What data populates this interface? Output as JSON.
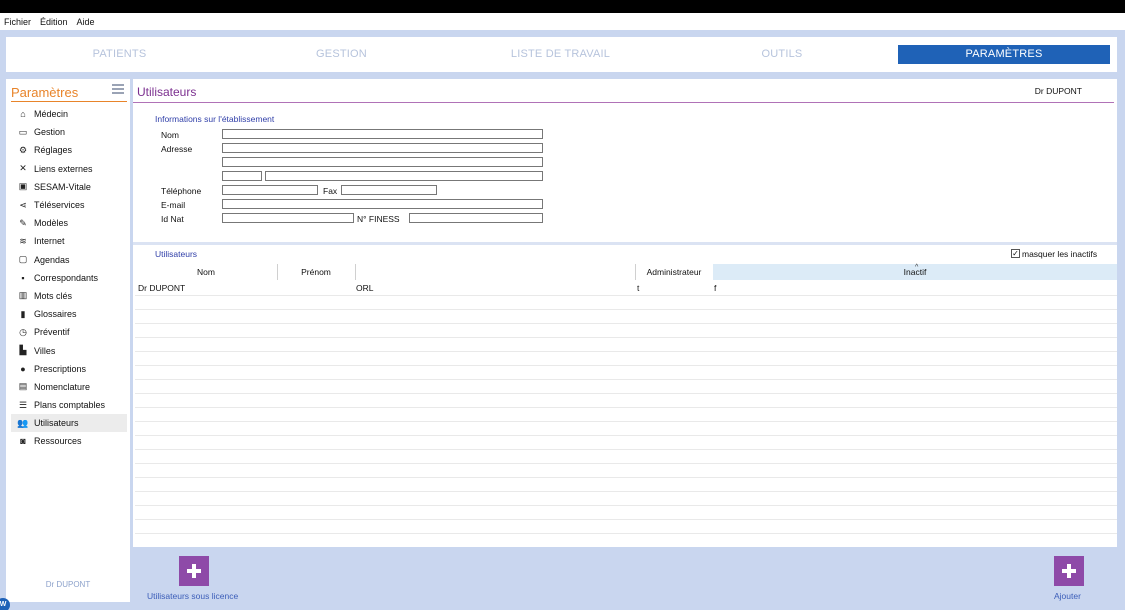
{
  "menubar": [
    "Fichier",
    "Édition",
    "Aide"
  ],
  "nav": {
    "tabs": [
      {
        "label": "PATIENTS",
        "active": false
      },
      {
        "label": "GESTION",
        "active": false
      },
      {
        "label": "LISTE DE TRAVAIL",
        "active": false
      },
      {
        "label": "OUTILS",
        "active": false
      },
      {
        "label": "PARAMÈTRES",
        "active": true
      }
    ]
  },
  "sidebar": {
    "title": "Paramètres",
    "items": [
      {
        "label": "Médecin",
        "icon": "home-icon"
      },
      {
        "label": "Gestion",
        "icon": "inbox-icon"
      },
      {
        "label": "Réglages",
        "icon": "gears-icon"
      },
      {
        "label": "Liens externes",
        "icon": "expand-icon"
      },
      {
        "label": "SESAM-Vitale",
        "icon": "card-icon"
      },
      {
        "label": "Téléservices",
        "icon": "share-icon"
      },
      {
        "label": "Modèles",
        "icon": "edit-icon"
      },
      {
        "label": "Internet",
        "icon": "wifi-icon"
      },
      {
        "label": "Agendas",
        "icon": "calendar-icon"
      },
      {
        "label": "Correspondants",
        "icon": "contact-icon"
      },
      {
        "label": "Mots clés",
        "icon": "chart-icon"
      },
      {
        "label": "Glossaires",
        "icon": "clipboard-icon"
      },
      {
        "label": "Préventif",
        "icon": "clock-icon"
      },
      {
        "label": "Villes",
        "icon": "building-icon"
      },
      {
        "label": "Prescriptions",
        "icon": "pills-icon"
      },
      {
        "label": "Nomenclature",
        "icon": "document-icon"
      },
      {
        "label": "Plans comptables",
        "icon": "list-icon"
      },
      {
        "label": "Utilisateurs",
        "icon": "users-icon"
      },
      {
        "label": "Ressources",
        "icon": "car-icon"
      }
    ],
    "active_item": "Utilisateurs",
    "user": "Dr DUPONT"
  },
  "main": {
    "title": "Utilisateurs",
    "user": "Dr DUPONT",
    "establishment": {
      "section_label": "Informations sur l'établissement",
      "nom_label": "Nom",
      "adresse_label": "Adresse",
      "telephone_label": "Téléphone",
      "fax_label": "Fax",
      "email_label": "E-mail",
      "idnat_label": "Id Nat",
      "finess_label": "N° FINESS",
      "nom": "",
      "adresse1": "",
      "adresse2": "",
      "code_postal": "",
      "ville": "",
      "telephone": "",
      "fax": "",
      "email": "",
      "idnat": "",
      "finess": ""
    },
    "users": {
      "section_label": "Utilisateurs",
      "hide_inactive_label": "masquer les inactifs",
      "hide_inactive_checked": true,
      "columns": [
        "Nom",
        "Prénom",
        "",
        "Administrateur",
        "Inactif"
      ],
      "sorted_column": "Inactif",
      "rows": [
        {
          "nom": "Dr DUPONT",
          "prenom": "",
          "specialite": "ORL",
          "administrateur": "t",
          "inactif": "f"
        }
      ]
    }
  },
  "bottom": {
    "licensed_users_label": "Utilisateurs sous licence",
    "add_label": "Ajouter"
  },
  "colors": {
    "nav_active": "#1f62b7",
    "sidebar_title": "#e8842a",
    "page_title": "#7b2f8f",
    "add_button": "#8e4aa8",
    "background": "#c9d6ef"
  }
}
